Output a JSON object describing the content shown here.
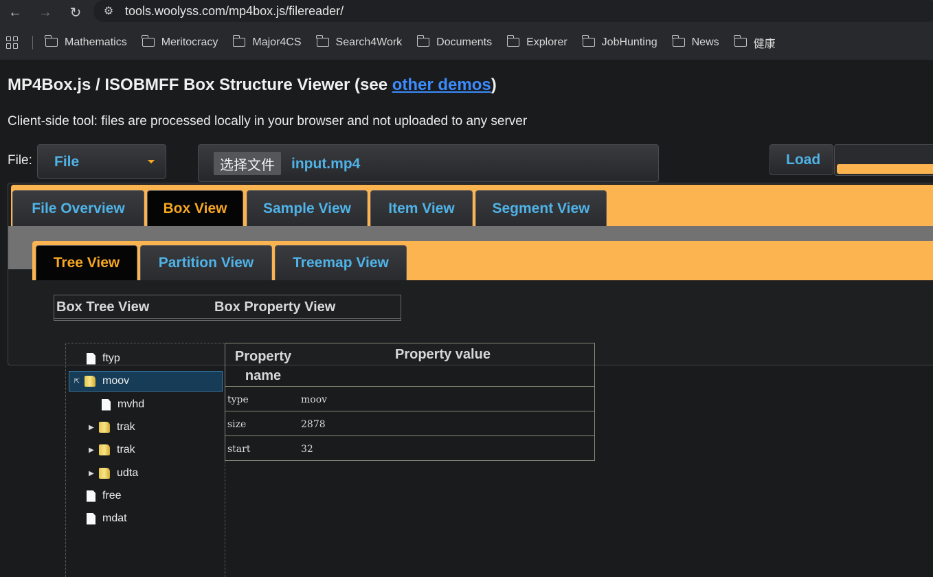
{
  "browser": {
    "url": "tools.woolyss.com/mp4box.js/filereader/",
    "bookmarks": [
      "Mathematics",
      "Meritocracy",
      "Major4CS",
      "Search4Work",
      "Documents",
      "Explorer",
      "JobHunting",
      "News",
      "健康"
    ]
  },
  "page": {
    "title_prefix": "MP4Box.js / ISOBMFF Box Structure Viewer (see ",
    "title_link": "other demos",
    "title_suffix": ")",
    "subtitle": "Client-side tool: files are processed locally in your browser and not uploaded to any server",
    "file_label": "File:",
    "file_select_value": "File",
    "choose_file_button": "选择文件",
    "file_name": "input.mp4",
    "load_button": "Load",
    "progress": 1.0
  },
  "main_tabs": [
    "File Overview",
    "Box View",
    "Sample View",
    "Item View",
    "Segment View"
  ],
  "active_main_tab": "Box View",
  "sub_tabs": [
    "Tree View",
    "Partition View",
    "Treemap View"
  ],
  "active_sub_tab": "Tree View",
  "split_header": {
    "left": "Box Tree View",
    "right": "Box Property View"
  },
  "tree": {
    "ftyp": "ftyp",
    "moov": "moov",
    "mvhd": "mvhd",
    "trak1": "trak",
    "trak2": "trak",
    "udta": "udta",
    "free": "free",
    "mdat": "mdat"
  },
  "property_table": {
    "header_name": "Property name",
    "header_value": "Property value",
    "rows": [
      {
        "key": "type",
        "value": "moov"
      },
      {
        "key": "size",
        "value": "2878"
      },
      {
        "key": "start",
        "value": "32"
      }
    ]
  }
}
